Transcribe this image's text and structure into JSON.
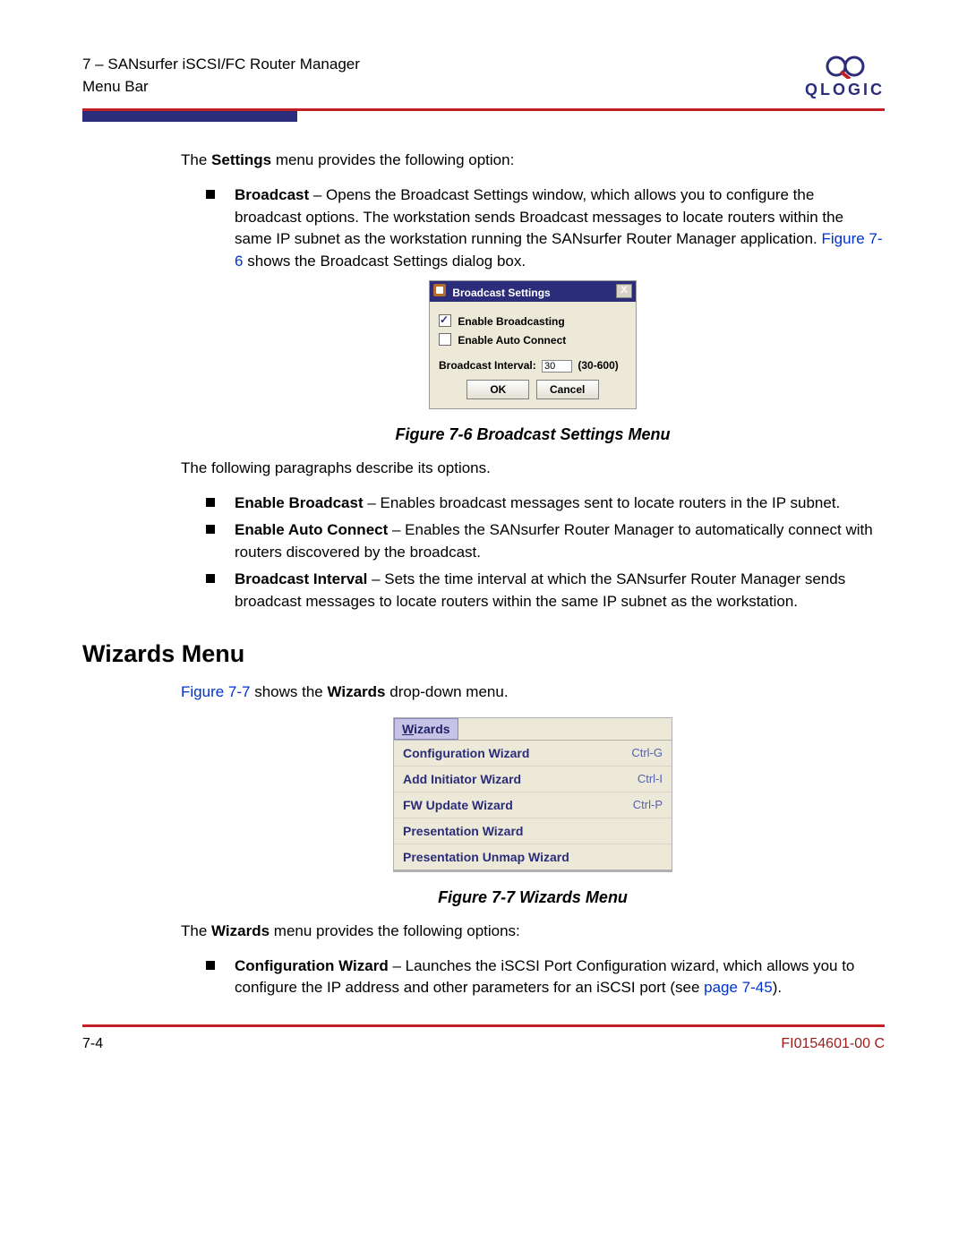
{
  "header": {
    "chapter_line": "7 – SANsurfer iSCSI/FC Router Manager",
    "section_line": "Menu Bar",
    "logo_text": "QLOGIC"
  },
  "intro_1a": "The ",
  "intro_1b": "Settings",
  "intro_1c": " menu provides the following option:",
  "broadcast_bullet": {
    "label": "Broadcast",
    "text_a": " – Opens the Broadcast Settings window, which allows you to configure the broadcast options. The workstation sends Broadcast messages to locate routers within the same IP subnet as the workstation running the SANsurfer Router Manager application. ",
    "xref": "Figure 7-6",
    "text_b": " shows the Broadcast Settings dialog box."
  },
  "dialog": {
    "title": "Broadcast Settings",
    "close_glyph": "X",
    "opt1": "Enable Broadcasting",
    "opt2": "Enable Auto Connect",
    "interval_label": "Broadcast Interval:",
    "interval_value": "30",
    "interval_range": "(30-600)",
    "ok": "OK",
    "cancel": "Cancel"
  },
  "fig6_caption": "Figure 7-6  Broadcast Settings Menu",
  "options_intro": "The following paragraphs describe its options.",
  "options": [
    {
      "label": "Enable Broadcast",
      "text": " – Enables broadcast messages sent to locate routers in the IP subnet."
    },
    {
      "label": "Enable Auto Connect",
      "text": " – Enables the SANsurfer Router Manager to automatically connect with routers discovered by the broadcast."
    },
    {
      "label": "Broadcast Interval",
      "text": " – Sets the time interval at which the SANsurfer Router Manager sends broadcast messages to locate routers within the same IP subnet as the workstation."
    }
  ],
  "wizards_heading": "Wizards Menu",
  "wizards_intro": {
    "xref": "Figure 7-7",
    "a": " shows the ",
    "b": "Wizards",
    "c": " drop-down menu."
  },
  "menu": {
    "header": "Wizards",
    "items": [
      {
        "label": "Configuration Wizard",
        "sc": "Ctrl-G"
      },
      {
        "label": "Add Initiator Wizard",
        "sc": "Ctrl-I"
      },
      {
        "label": "FW Update Wizard",
        "sc": "Ctrl-P"
      },
      {
        "label": "Presentation Wizard",
        "sc": ""
      },
      {
        "label": "Presentation Unmap Wizard",
        "sc": ""
      }
    ]
  },
  "fig7_caption": "Figure 7-7  Wizards Menu",
  "wizards_opts_intro_a": "The ",
  "wizards_opts_intro_b": "Wizards",
  "wizards_opts_intro_c": " menu provides the following options:",
  "config_wizard": {
    "label": "Configuration Wizard",
    "text_a": " – Launches the iSCSI Port Configuration wizard, which allows you to configure the IP address and other parameters for an iSCSI port (see ",
    "xref": "page 7-45",
    "text_b": ")."
  },
  "footer": {
    "page": "7-4",
    "docno": "FI0154601-00  C"
  }
}
